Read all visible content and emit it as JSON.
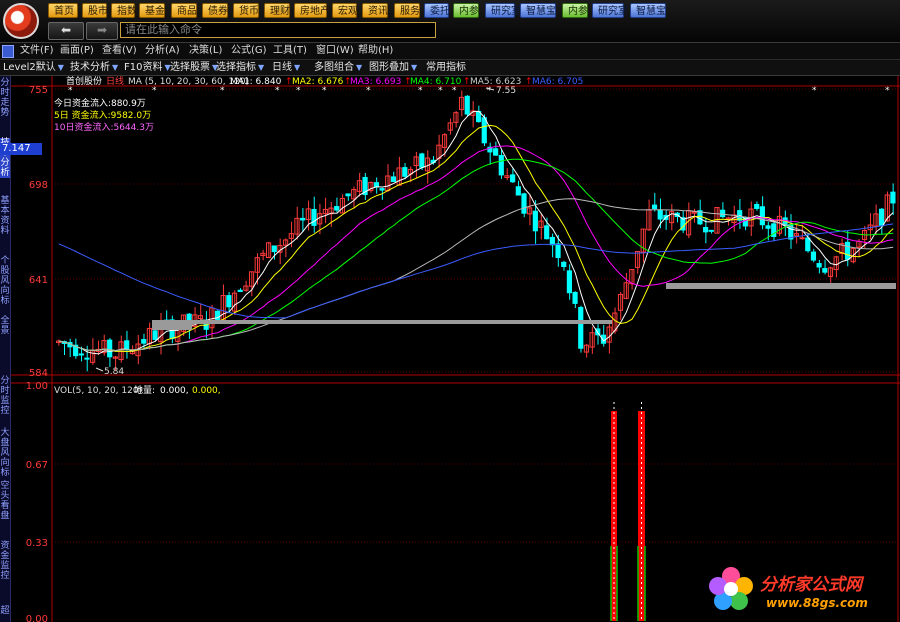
{
  "nav": {
    "buttons": [
      "首页",
      "股市",
      "指数",
      "基金",
      "商品",
      "债券",
      "货币",
      "理财",
      "房地产",
      "宏观",
      "资讯",
      "服务",
      "委托",
      "内参",
      "研究室",
      "智慧宝",
      "内参",
      "研究室",
      "智慧宝"
    ]
  },
  "command": {
    "placeholder": "请在此输入命令"
  },
  "menu": [
    "文件(F)",
    "画面(P)",
    "查看(V)",
    "分析(A)",
    "决策(L)",
    "公式(G)",
    "工具(T)",
    "窗口(W)",
    "帮助(H)"
  ],
  "toolbar": [
    "Level2默认",
    "技术分析",
    "F10资料",
    "选择股票",
    "选择指标",
    "日线",
    "多图组合",
    "图形叠加",
    "常用指标"
  ],
  "sidebar": {
    "tabs": [
      "分时走势",
      "技术分析",
      "基本资料",
      "个股风向标",
      "全景",
      "分时监控",
      "大盘风向标",
      "空头看盘",
      "资金监控",
      "超"
    ],
    "price_box": "7.147"
  },
  "main_chart": {
    "stock_name": "首创股份",
    "period": "日线",
    "ma_label": "MA (5, 10, 20, 30, 60, 120)",
    "ma_values": [
      {
        "name": "MA1:",
        "value": "6.840",
        "color": "#ffffff"
      },
      {
        "name": "MA2:",
        "value": "6.676",
        "color": "#ffff00"
      },
      {
        "name": "MA3:",
        "value": "6.693",
        "color": "#ff00ff"
      },
      {
        "name": "MA4:",
        "value": "6.710",
        "color": "#00ff00"
      },
      {
        "name": "MA5:",
        "value": "6.623",
        "color": "#cccccc"
      },
      {
        "name": "MA6:",
        "value": "6.705",
        "color": "#3a5cff"
      }
    ],
    "fund_flow": [
      {
        "text": "今日资金流入:880.9万",
        "color": "#ffffff"
      },
      {
        "text": "5日 资金流入:9582.0万",
        "color": "#ffff00"
      },
      {
        "text": "10日资金流入:5644.3万",
        "color": "#ff66ff"
      }
    ],
    "y_ticks": [
      "755",
      "698",
      "641",
      "584"
    ],
    "high_label": "7.55",
    "low_label": "5.84"
  },
  "sub_chart": {
    "title": "VOL(5, 10, 20, 120)",
    "indicator": "地量:",
    "values": [
      "0.000,",
      "0.000,"
    ],
    "y_ticks": [
      "1.00",
      "0.67",
      "0.33",
      "0.00"
    ]
  },
  "watermark": {
    "text": "分析家公式网",
    "url": "www.88gs.com"
  },
  "colors": {
    "up": "#ff3b3b",
    "down": "#00ffff",
    "accent": "#ff0000"
  }
}
